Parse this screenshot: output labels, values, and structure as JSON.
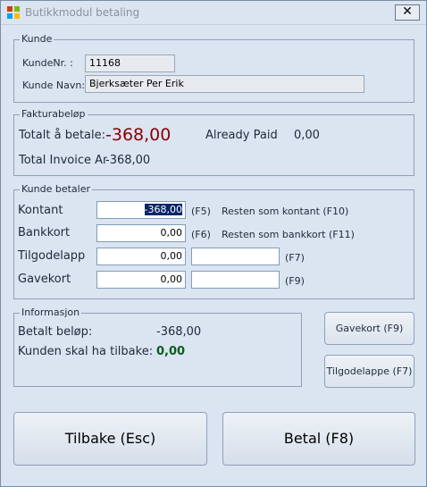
{
  "window": {
    "title": "Butikkmodul betaling",
    "close_glyph": "✕"
  },
  "kunde": {
    "group_label": "Kunde",
    "nr_label": "KundeNr. :",
    "nr_value": "11168",
    "navn_label": "Kunde Navn:",
    "navn_value": "Bjerksæter Per Erik"
  },
  "faktura": {
    "group_label": "Fakturabeløp",
    "totalt_label": "Totalt å betale:",
    "totalt_value": "-368,00",
    "already_paid_label": "Already Paid",
    "already_paid_value": "0,00",
    "total_invoice_label": "Total Invoice Am",
    "total_invoice_value": "-368,00"
  },
  "betaler": {
    "group_label": "Kunde betaler",
    "rows": [
      {
        "label": "Kontant",
        "value": "-368,00",
        "shortcut": "(F5)",
        "note": "Resten som kontant (F10)"
      },
      {
        "label": "Bankkort",
        "value": "0,00",
        "shortcut": "(F6)",
        "note": "Resten som bankkort (F11)"
      },
      {
        "label": "Tilgodelapp",
        "value": "0,00",
        "extra": "",
        "shortcut": "(F7)"
      },
      {
        "label": "Gavekort",
        "value": "0,00",
        "extra": "",
        "shortcut": "(F9)"
      }
    ]
  },
  "info": {
    "group_label": "Informasjon",
    "betalt_label": "Betalt beløp:",
    "betalt_value": "-368,00",
    "tilbake_label": "Kunden skal ha tilbake:",
    "tilbake_value": "0,00"
  },
  "side_buttons": {
    "gavekort": "Gavekort (F9)",
    "tilgodelappe": "Tilgodelappe (F7)"
  },
  "footer": {
    "tilbake": "Tilbake (Esc)",
    "betal": "Betal (F8)"
  },
  "colors": {
    "accent_red": "#8b0000",
    "accent_green": "#0a5a1e",
    "selection": "#0a246a"
  }
}
